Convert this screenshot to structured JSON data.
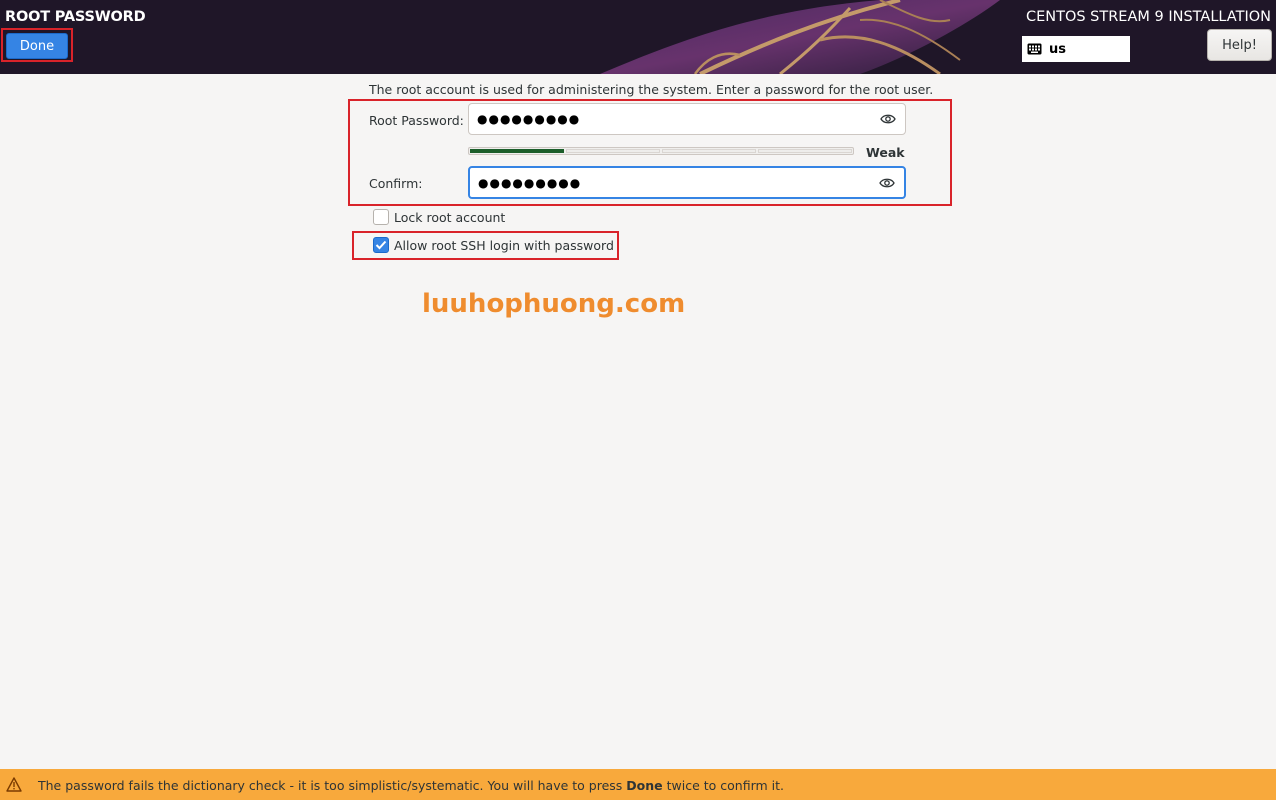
{
  "header": {
    "title": "ROOT PASSWORD",
    "done_label": "Done",
    "product": "CENTOS STREAM 9 INSTALLATION",
    "keyboard_layout": "us",
    "help_label": "Help!"
  },
  "form": {
    "intro": "The root account is used for administering the system.  Enter a password for the root user.",
    "root_password_label": "Root Password:",
    "root_password_value": "●●●●●●●●●",
    "strength_label": "Weak",
    "strength_level": 0.25,
    "confirm_label": "Confirm:",
    "confirm_value": "●●●●●●●●●",
    "lock_root_label": "Lock root account",
    "lock_root_checked": false,
    "allow_ssh_label": "Allow root SSH login with password",
    "allow_ssh_checked": true
  },
  "watermark": "luuhophuong.com",
  "footer": {
    "message_prefix": "The password fails the dictionary check - it is too simplistic/systematic. You will have to press ",
    "message_bold": "Done",
    "message_suffix": " twice to confirm it."
  },
  "colors": {
    "accent": "#3584e4",
    "highlight_box": "#d9232a",
    "footer_warning": "#f8a93c",
    "strength_fill": "#1c5e2a",
    "watermark": "#ef8c2e"
  },
  "icons": {
    "keyboard": "keyboard-icon",
    "eye": "eye-icon",
    "check": "check-icon",
    "warning": "warning-icon"
  }
}
